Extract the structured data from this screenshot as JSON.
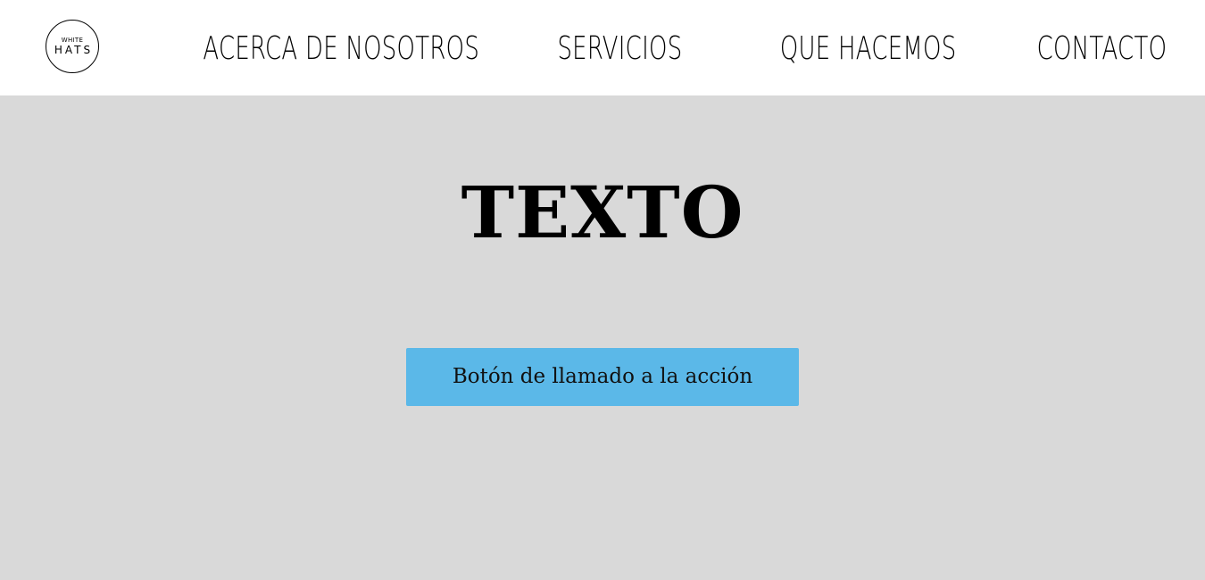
{
  "header": {
    "logo": {
      "top_text": "WHITE",
      "bottom_text": "HATS"
    },
    "nav": [
      {
        "label": "ACERCA DE NOSOTROS"
      },
      {
        "label": "SERVICIOS"
      },
      {
        "label": "QUE HACEMOS"
      },
      {
        "label": "CONTACTO"
      }
    ]
  },
  "hero": {
    "title": "TEXTO",
    "cta_label": "Botón de llamado a la acción",
    "background_color": "#d9d9d9",
    "cta_color": "#5bb8e8"
  }
}
